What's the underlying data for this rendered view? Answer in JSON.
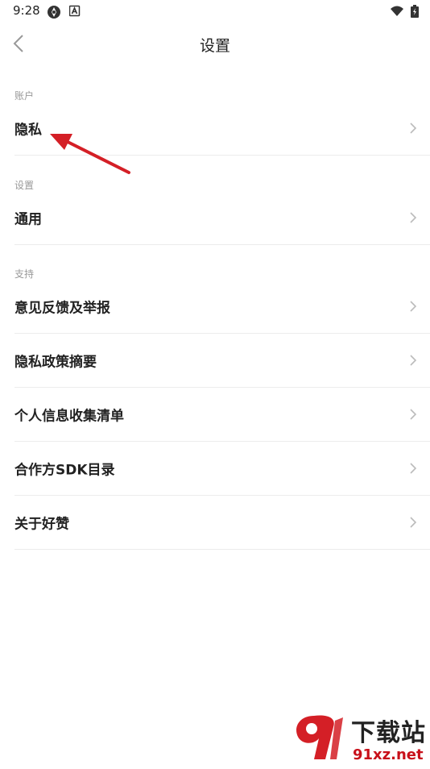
{
  "status_bar": {
    "time": "9:28"
  },
  "header": {
    "title": "设置"
  },
  "sections": {
    "account": {
      "label": "账户",
      "items": [
        "隐私"
      ]
    },
    "settings": {
      "label": "设置",
      "items": [
        "通用"
      ]
    },
    "support": {
      "label": "支持",
      "items": [
        "意见反馈及举报",
        "隐私政策摘要",
        "个人信息收集清单",
        "合作方SDK目录",
        "关于好赞"
      ]
    }
  },
  "watermark": {
    "name": "下载站",
    "url": "91xz.net"
  },
  "colors": {
    "annotation_arrow": "#d41f26",
    "watermark_red": "#c8101a"
  }
}
